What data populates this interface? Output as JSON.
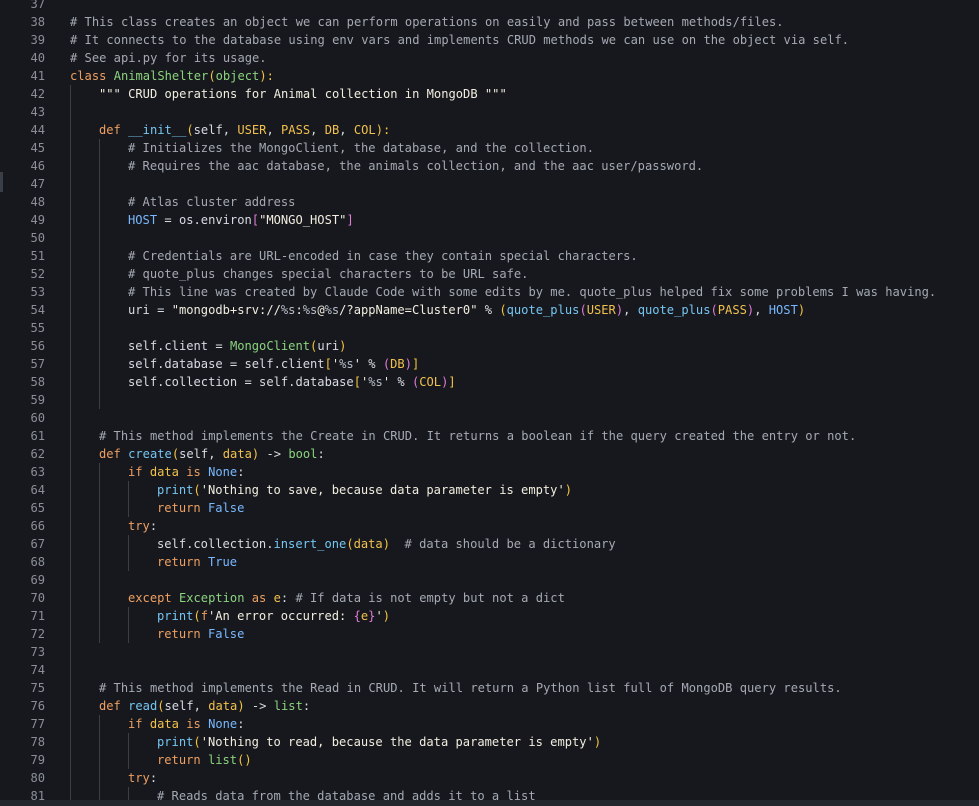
{
  "editor": {
    "lines": [
      {
        "num": "37",
        "indent": 0,
        "tokens": []
      },
      {
        "num": "38",
        "indent": 0,
        "tokens": [
          [
            "comment",
            "# This class creates an object we can perform operations on easily and pass between methods/files."
          ]
        ]
      },
      {
        "num": "39",
        "indent": 0,
        "tokens": [
          [
            "comment",
            "# It connects to the database using env vars and implements CRUD methods we can use on the object via self."
          ]
        ]
      },
      {
        "num": "40",
        "indent": 0,
        "tokens": [
          [
            "comment",
            "# See api.py for its usage."
          ]
        ]
      },
      {
        "num": "41",
        "indent": 0,
        "tokens": [
          [
            "kw",
            "class "
          ],
          [
            "class",
            "AnimalShelter"
          ],
          [
            "bracket",
            "("
          ],
          [
            "builtin",
            "object"
          ],
          [
            "bracket",
            "):"
          ]
        ]
      },
      {
        "num": "42",
        "indent": 1,
        "tokens": [
          [
            "string",
            "\"\"\" CRUD operations for Animal collection in MongoDB \"\"\""
          ]
        ]
      },
      {
        "num": "43",
        "indent": 1,
        "tokens": []
      },
      {
        "num": "44",
        "indent": 1,
        "tokens": [
          [
            "kw",
            "def "
          ],
          [
            "func",
            "__init__"
          ],
          [
            "bracket",
            "("
          ],
          [
            "self",
            "self, "
          ],
          [
            "param",
            "USER"
          ],
          [
            "op",
            ", "
          ],
          [
            "param",
            "PASS"
          ],
          [
            "op",
            ", "
          ],
          [
            "param",
            "DB"
          ],
          [
            "op",
            ", "
          ],
          [
            "param",
            "COL"
          ],
          [
            "bracket",
            "):"
          ]
        ]
      },
      {
        "num": "45",
        "indent": 2,
        "tokens": [
          [
            "comment",
            "# Initializes the MongoClient, the database, and the collection."
          ]
        ]
      },
      {
        "num": "46",
        "indent": 2,
        "tokens": [
          [
            "comment",
            "# Requires the aac database, the animals collection, and the aac user/password."
          ]
        ]
      },
      {
        "num": "47",
        "indent": 2,
        "tokens": []
      },
      {
        "num": "48",
        "indent": 2,
        "tokens": [
          [
            "comment",
            "# Atlas cluster address"
          ]
        ]
      },
      {
        "num": "49",
        "indent": 2,
        "tokens": [
          [
            "const",
            "HOST"
          ],
          [
            "op",
            " = os.environ"
          ],
          [
            "bracket2",
            "["
          ],
          [
            "string",
            "\"MONGO_HOST\""
          ],
          [
            "bracket2",
            "]"
          ]
        ]
      },
      {
        "num": "50",
        "indent": 2,
        "tokens": []
      },
      {
        "num": "51",
        "indent": 2,
        "tokens": [
          [
            "comment",
            "# Credentials are URL-encoded in case they contain special characters."
          ]
        ]
      },
      {
        "num": "52",
        "indent": 2,
        "tokens": [
          [
            "comment",
            "# quote_plus changes special characters to be URL safe."
          ]
        ]
      },
      {
        "num": "53",
        "indent": 2,
        "tokens": [
          [
            "comment",
            "# This line was created by Claude Code with some edits by me. quote_plus helped fix some problems I was having."
          ]
        ]
      },
      {
        "num": "54",
        "indent": 2,
        "tokens": [
          [
            "op",
            "uri = "
          ],
          [
            "string",
            "\"mongodb+srv://"
          ],
          [
            "strfmt",
            "%s"
          ],
          [
            "string",
            ":"
          ],
          [
            "strfmt",
            "%s"
          ],
          [
            "string",
            "@"
          ],
          [
            "strfmt",
            "%s"
          ],
          [
            "string",
            "/?appName=Cluster0\""
          ],
          [
            "op",
            " % "
          ],
          [
            "bracket",
            "("
          ],
          [
            "func",
            "quote_plus"
          ],
          [
            "bracket2",
            "("
          ],
          [
            "param",
            "USER"
          ],
          [
            "bracket2",
            ")"
          ],
          [
            "op",
            ", "
          ],
          [
            "func",
            "quote_plus"
          ],
          [
            "bracket2",
            "("
          ],
          [
            "param",
            "PASS"
          ],
          [
            "bracket2",
            ")"
          ],
          [
            "op",
            ", "
          ],
          [
            "const",
            "HOST"
          ],
          [
            "bracket",
            ")"
          ]
        ]
      },
      {
        "num": "55",
        "indent": 2,
        "tokens": []
      },
      {
        "num": "56",
        "indent": 2,
        "tokens": [
          [
            "self",
            "self.client = "
          ],
          [
            "class",
            "MongoClient"
          ],
          [
            "bracket",
            "("
          ],
          [
            "op",
            "uri"
          ],
          [
            "bracket",
            ")"
          ]
        ]
      },
      {
        "num": "57",
        "indent": 2,
        "tokens": [
          [
            "self",
            "self.database = self.client"
          ],
          [
            "bracket",
            "["
          ],
          [
            "string",
            "'"
          ],
          [
            "strfmt",
            "%s"
          ],
          [
            "string",
            "'"
          ],
          [
            "op",
            " % "
          ],
          [
            "bracket2",
            "("
          ],
          [
            "param",
            "DB"
          ],
          [
            "bracket2",
            ")"
          ],
          [
            "bracket",
            "]"
          ]
        ]
      },
      {
        "num": "58",
        "indent": 2,
        "tokens": [
          [
            "self",
            "self.collection = self.database"
          ],
          [
            "bracket",
            "["
          ],
          [
            "string",
            "'"
          ],
          [
            "strfmt",
            "%s"
          ],
          [
            "string",
            "'"
          ],
          [
            "op",
            " % "
          ],
          [
            "bracket2",
            "("
          ],
          [
            "param",
            "COL"
          ],
          [
            "bracket2",
            ")"
          ],
          [
            "bracket",
            "]"
          ]
        ]
      },
      {
        "num": "59",
        "indent": 2,
        "tokens": []
      },
      {
        "num": "60",
        "indent": 1,
        "tokens": []
      },
      {
        "num": "61",
        "indent": 1,
        "tokens": [
          [
            "comment",
            "# This method implements the Create in CRUD. It returns a boolean if the query created the entry or not."
          ]
        ]
      },
      {
        "num": "62",
        "indent": 1,
        "tokens": [
          [
            "kw",
            "def "
          ],
          [
            "func",
            "create"
          ],
          [
            "bracket",
            "("
          ],
          [
            "self",
            "self, "
          ],
          [
            "param",
            "data"
          ],
          [
            "bracket",
            ")"
          ],
          [
            "op",
            " -> "
          ],
          [
            "builtin",
            "bool"
          ],
          [
            "op",
            ":"
          ]
        ]
      },
      {
        "num": "63",
        "indent": 2,
        "tokens": [
          [
            "kw",
            "if "
          ],
          [
            "param",
            "data"
          ],
          [
            "kw",
            " is "
          ],
          [
            "const",
            "None"
          ],
          [
            "op",
            ":"
          ]
        ]
      },
      {
        "num": "64",
        "indent": 3,
        "tokens": [
          [
            "func",
            "print"
          ],
          [
            "bracket",
            "("
          ],
          [
            "string",
            "'Nothing to save, because data parameter is empty'"
          ],
          [
            "bracket",
            ")"
          ]
        ]
      },
      {
        "num": "65",
        "indent": 3,
        "tokens": [
          [
            "kw",
            "return "
          ],
          [
            "const",
            "False"
          ]
        ]
      },
      {
        "num": "66",
        "indent": 2,
        "tokens": [
          [
            "kw",
            "try"
          ],
          [
            "op",
            ":"
          ]
        ]
      },
      {
        "num": "67",
        "indent": 3,
        "tokens": [
          [
            "self",
            "self.collection."
          ],
          [
            "func",
            "insert_one"
          ],
          [
            "bracket",
            "("
          ],
          [
            "param",
            "data"
          ],
          [
            "bracket",
            ")"
          ],
          [
            "comment",
            "  # data should be a dictionary"
          ]
        ]
      },
      {
        "num": "68",
        "indent": 3,
        "tokens": [
          [
            "kw",
            "return "
          ],
          [
            "const",
            "True"
          ]
        ]
      },
      {
        "num": "69",
        "indent": 2,
        "tokens": []
      },
      {
        "num": "70",
        "indent": 2,
        "tokens": [
          [
            "kw",
            "except "
          ],
          [
            "builtin",
            "Exception"
          ],
          [
            "kw",
            " as "
          ],
          [
            "param",
            "e"
          ],
          [
            "op",
            ": "
          ],
          [
            "comment",
            "# If data is not empty but not a dict"
          ]
        ]
      },
      {
        "num": "71",
        "indent": 3,
        "tokens": [
          [
            "func",
            "print"
          ],
          [
            "bracket",
            "("
          ],
          [
            "kw",
            "f"
          ],
          [
            "string",
            "'An error occurred: "
          ],
          [
            "bracket2",
            "{"
          ],
          [
            "param",
            "e"
          ],
          [
            "bracket2",
            "}"
          ],
          [
            "string",
            "'"
          ],
          [
            "bracket",
            ")"
          ]
        ]
      },
      {
        "num": "72",
        "indent": 3,
        "tokens": [
          [
            "kw",
            "return "
          ],
          [
            "const",
            "False"
          ]
        ]
      },
      {
        "num": "73",
        "indent": 1,
        "tokens": []
      },
      {
        "num": "74",
        "indent": 1,
        "tokens": []
      },
      {
        "num": "75",
        "indent": 1,
        "tokens": [
          [
            "comment",
            "# This method implements the Read in CRUD. It will return a Python list full of MongoDB query results."
          ]
        ]
      },
      {
        "num": "76",
        "indent": 1,
        "tokens": [
          [
            "kw",
            "def "
          ],
          [
            "func",
            "read"
          ],
          [
            "bracket",
            "("
          ],
          [
            "self",
            "self, "
          ],
          [
            "param",
            "data"
          ],
          [
            "bracket",
            ")"
          ],
          [
            "op",
            " -> "
          ],
          [
            "builtin",
            "list"
          ],
          [
            "op",
            ":"
          ]
        ]
      },
      {
        "num": "77",
        "indent": 2,
        "tokens": [
          [
            "kw",
            "if "
          ],
          [
            "param",
            "data"
          ],
          [
            "kw",
            " is "
          ],
          [
            "const",
            "None"
          ],
          [
            "op",
            ":"
          ]
        ]
      },
      {
        "num": "78",
        "indent": 3,
        "tokens": [
          [
            "func",
            "print"
          ],
          [
            "bracket",
            "("
          ],
          [
            "string",
            "'Nothing to read, because the data parameter is empty'"
          ],
          [
            "bracket",
            ")"
          ]
        ]
      },
      {
        "num": "79",
        "indent": 3,
        "tokens": [
          [
            "kw",
            "return "
          ],
          [
            "builtin",
            "list"
          ],
          [
            "bracket",
            "()"
          ]
        ]
      },
      {
        "num": "80",
        "indent": 2,
        "tokens": [
          [
            "kw",
            "try"
          ],
          [
            "op",
            ":"
          ]
        ]
      },
      {
        "num": "81",
        "indent": 3,
        "tokens": [
          [
            "comment",
            "# Reads data from the database and adds it to a list"
          ]
        ]
      }
    ]
  }
}
